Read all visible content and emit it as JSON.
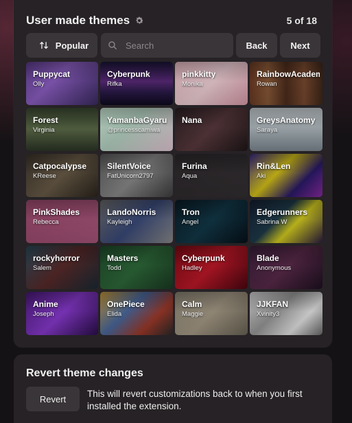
{
  "header": {
    "title": "User made themes",
    "page_count": "5 of 18"
  },
  "toolbar": {
    "sort_label": "Popular",
    "search_placeholder": "Search",
    "back_label": "Back",
    "next_label": "Next"
  },
  "themes": [
    {
      "name": "Puppycat",
      "author": "Olly",
      "bg": "linear-gradient(135deg,#5b3c8a 0%,#8d5fc4 40%,#3a2a60 100%)"
    },
    {
      "name": "Cyberpunk",
      "author": "Rifka",
      "bg": "linear-gradient(180deg,#1b1538 0%,#5a2a7a 45%,#2b1a4a 70%,#0e0a1e 100%)"
    },
    {
      "name": "pinkkitty",
      "author": "Monika",
      "bg": "linear-gradient(135deg,#e5b8c2 0%,#f3d3da 50%,#d99aa8 100%)"
    },
    {
      "name": "RainbowAcademy",
      "author": "Rowan",
      "bg": "linear-gradient(90deg,#6a3a24 0%,#8a5a38 25%,#4d2c1c 50%,#7a4a30 75%,#3e2618 100%)"
    },
    {
      "name": "Forest",
      "author": "Virginia",
      "bg": "linear-gradient(180deg,#3c4a32 0%,#5c6b48 50%,#2c3526 100%)"
    },
    {
      "name": "YamanbaGyaru",
      "author": "@princesscamiwa",
      "bg": "linear-gradient(135deg,#c9e6d4 0%,#b8d6c6 40%,#e4c9d6 100%)"
    },
    {
      "name": "Nana",
      "author": "",
      "bg": "linear-gradient(135deg,#2a1e22 0%,#5a3a3e 50%,#1e1618 100%)"
    },
    {
      "name": "GreysAnatomy",
      "author": "Saraya",
      "bg": "linear-gradient(180deg,#cfd6da 0%,#aeb8be 50%,#7e8a92 100%)"
    },
    {
      "name": "Catpocalypse",
      "author": "KReese",
      "bg": "linear-gradient(135deg,#3a332a 0%,#6a5c48 50%,#2a241c 100%)"
    },
    {
      "name": "SilentVoice",
      "author": "FatUnicorn2797",
      "bg": "linear-gradient(135deg,#5a5a5a 0%,#8c8c8c 50%,#3e3e3e 100%)"
    },
    {
      "name": "Furina",
      "author": "Aqua",
      "bg": "linear-gradient(135deg,#2e2a2d 0%,#332f32 100%)"
    },
    {
      "name": "Rin&Len",
      "author": "Aki",
      "bg": "linear-gradient(135deg,#3a2a8a 0%,#d8c418 40%,#2a1a6a 70%,#8a2aa0 100%)"
    },
    {
      "name": "PinkShades",
      "author": "Rebecca",
      "bg": "linear-gradient(135deg,#9c4a6e 0%,#a8557a 100%)"
    },
    {
      "name": "LandoNorris",
      "author": "Kayleigh",
      "bg": "linear-gradient(135deg,#6a6a6a 0%,#3a4a7a 50%,#8a8a8a 100%)"
    },
    {
      "name": "Tron",
      "author": "Angel",
      "bg": "linear-gradient(135deg,#0a1a24 0%,#123848 50%,#061018 100%)"
    },
    {
      "name": "Edgerunners",
      "author": "Sabrina W",
      "bg": "linear-gradient(135deg,#141e30 0%,#1e3a4a 40%,#d8d020 60%,#2a1a40 100%)"
    },
    {
      "name": "rockyhorror",
      "author": "Salem",
      "bg": "linear-gradient(135deg,#2a4a5a 0%,#5a2a2a 50%,#1a2a34 100%)"
    },
    {
      "name": "Masters",
      "author": "Todd",
      "bg": "linear-gradient(135deg,#1e4a2a 0%,#2e6a3a 50%,#1a3a22 100%)"
    },
    {
      "name": "Cyberpunk",
      "author": "Hadley",
      "bg": "linear-gradient(135deg,#7a0a14 0%,#c01828 50%,#4a0610 100%)"
    },
    {
      "name": "Blade",
      "author": "Anonymous",
      "bg": "linear-gradient(135deg,#3a1e3a 0%,#5a2a4a 50%,#1e1020 100%)"
    },
    {
      "name": "Anime",
      "author": "Joseph",
      "bg": "linear-gradient(135deg,#4a1a7a 0%,#8a3ad0 50%,#2a0e4a 100%)"
    },
    {
      "name": "OnePiece",
      "author": "Elida",
      "bg": "linear-gradient(135deg,#c89a3a 0%,#4a6aa0 40%,#a03a2a 70%,#2a2a2a 100%)"
    },
    {
      "name": "Calm",
      "author": "Maggie",
      "bg": "linear-gradient(135deg,#8a8474 0%,#a89c88 50%,#6a6456 100%)"
    },
    {
      "name": "JJKFAN",
      "author": "Xvinity3",
      "bg": "linear-gradient(135deg,#d8d8d8 0%,#9a9a9a 40%,#e8e8e8 70%,#6a6a6a 100%)"
    }
  ],
  "revert": {
    "title": "Revert theme changes",
    "button_label": "Revert",
    "description": "This will revert customizations back to when you first installed the extension."
  },
  "icons": [
    "gear-icon",
    "sort-icon",
    "search-icon"
  ]
}
